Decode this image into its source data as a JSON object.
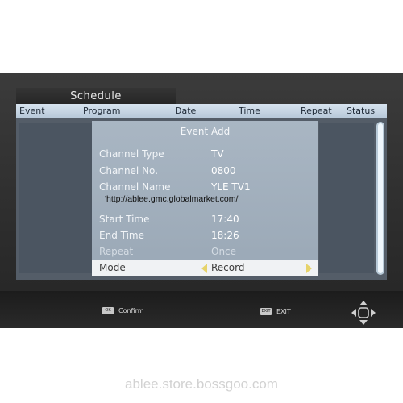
{
  "schedule": {
    "title": "Schedule",
    "columns": {
      "event": "Event",
      "program": "Program",
      "date": "Date",
      "time": "Time",
      "repeat": "Repeat",
      "status": "Status"
    }
  },
  "dialog": {
    "title": "Event Add",
    "rows": [
      {
        "label": "Channel Type",
        "value": "TV"
      },
      {
        "label": "Channel No.",
        "value": "0800"
      },
      {
        "label": "Channel Name",
        "value": "YLE TV1"
      },
      {
        "label": "Start Time",
        "value": "17:40"
      },
      {
        "label": "End Time",
        "value": "18:26"
      },
      {
        "label": "Repeat",
        "value": "Once"
      },
      {
        "label": "Mode",
        "value": "Record"
      }
    ]
  },
  "overlay_url": "'http://ablee.gmc.globalmarket.com/'",
  "footer": {
    "ok_key": "OK",
    "confirm_label": "Confirm",
    "exit_key": "EXIT",
    "exit_label": "EXIT"
  },
  "watermark": "ablee.store.bossgoo.com",
  "colors": {
    "dialog_bg": "#a4b2c0",
    "highlight_row": "#f0f2f4",
    "arrow": "#e6d36a",
    "header_bar": "#c8d6e4"
  }
}
